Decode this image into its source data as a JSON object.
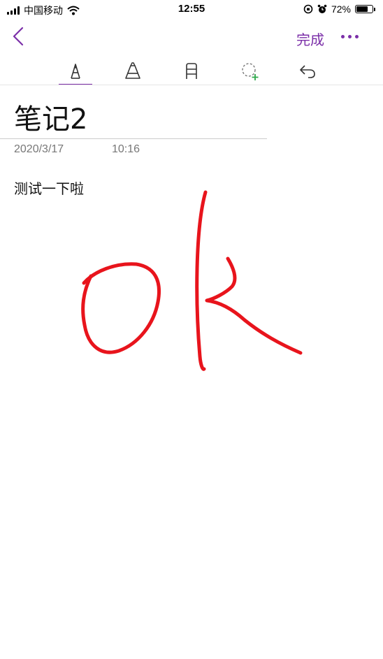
{
  "status_bar": {
    "carrier": "中国移动",
    "time": "12:55",
    "battery_percent": "72%",
    "battery_level": 0.72
  },
  "nav": {
    "back_icon": "chevron-left-icon",
    "done_label": "完成",
    "more_icon": "more-horizontal-icon",
    "accent_color": "#7b2fa8"
  },
  "toolbar": {
    "tools": [
      {
        "name": "pen-tool",
        "icon": "pen-icon",
        "active": true
      },
      {
        "name": "highlighter-tool",
        "icon": "highlighter-icon",
        "active": false
      },
      {
        "name": "eraser-tool",
        "icon": "eraser-icon",
        "active": false
      },
      {
        "name": "lasso-select-tool",
        "icon": "lasso-select-icon",
        "active": false
      },
      {
        "name": "undo-tool",
        "icon": "undo-icon",
        "active": false
      }
    ]
  },
  "note": {
    "title": "笔记2",
    "date": "2020/3/17",
    "time": "10:16",
    "body_text": "测试一下啦",
    "ink_color": "#e8141c"
  }
}
